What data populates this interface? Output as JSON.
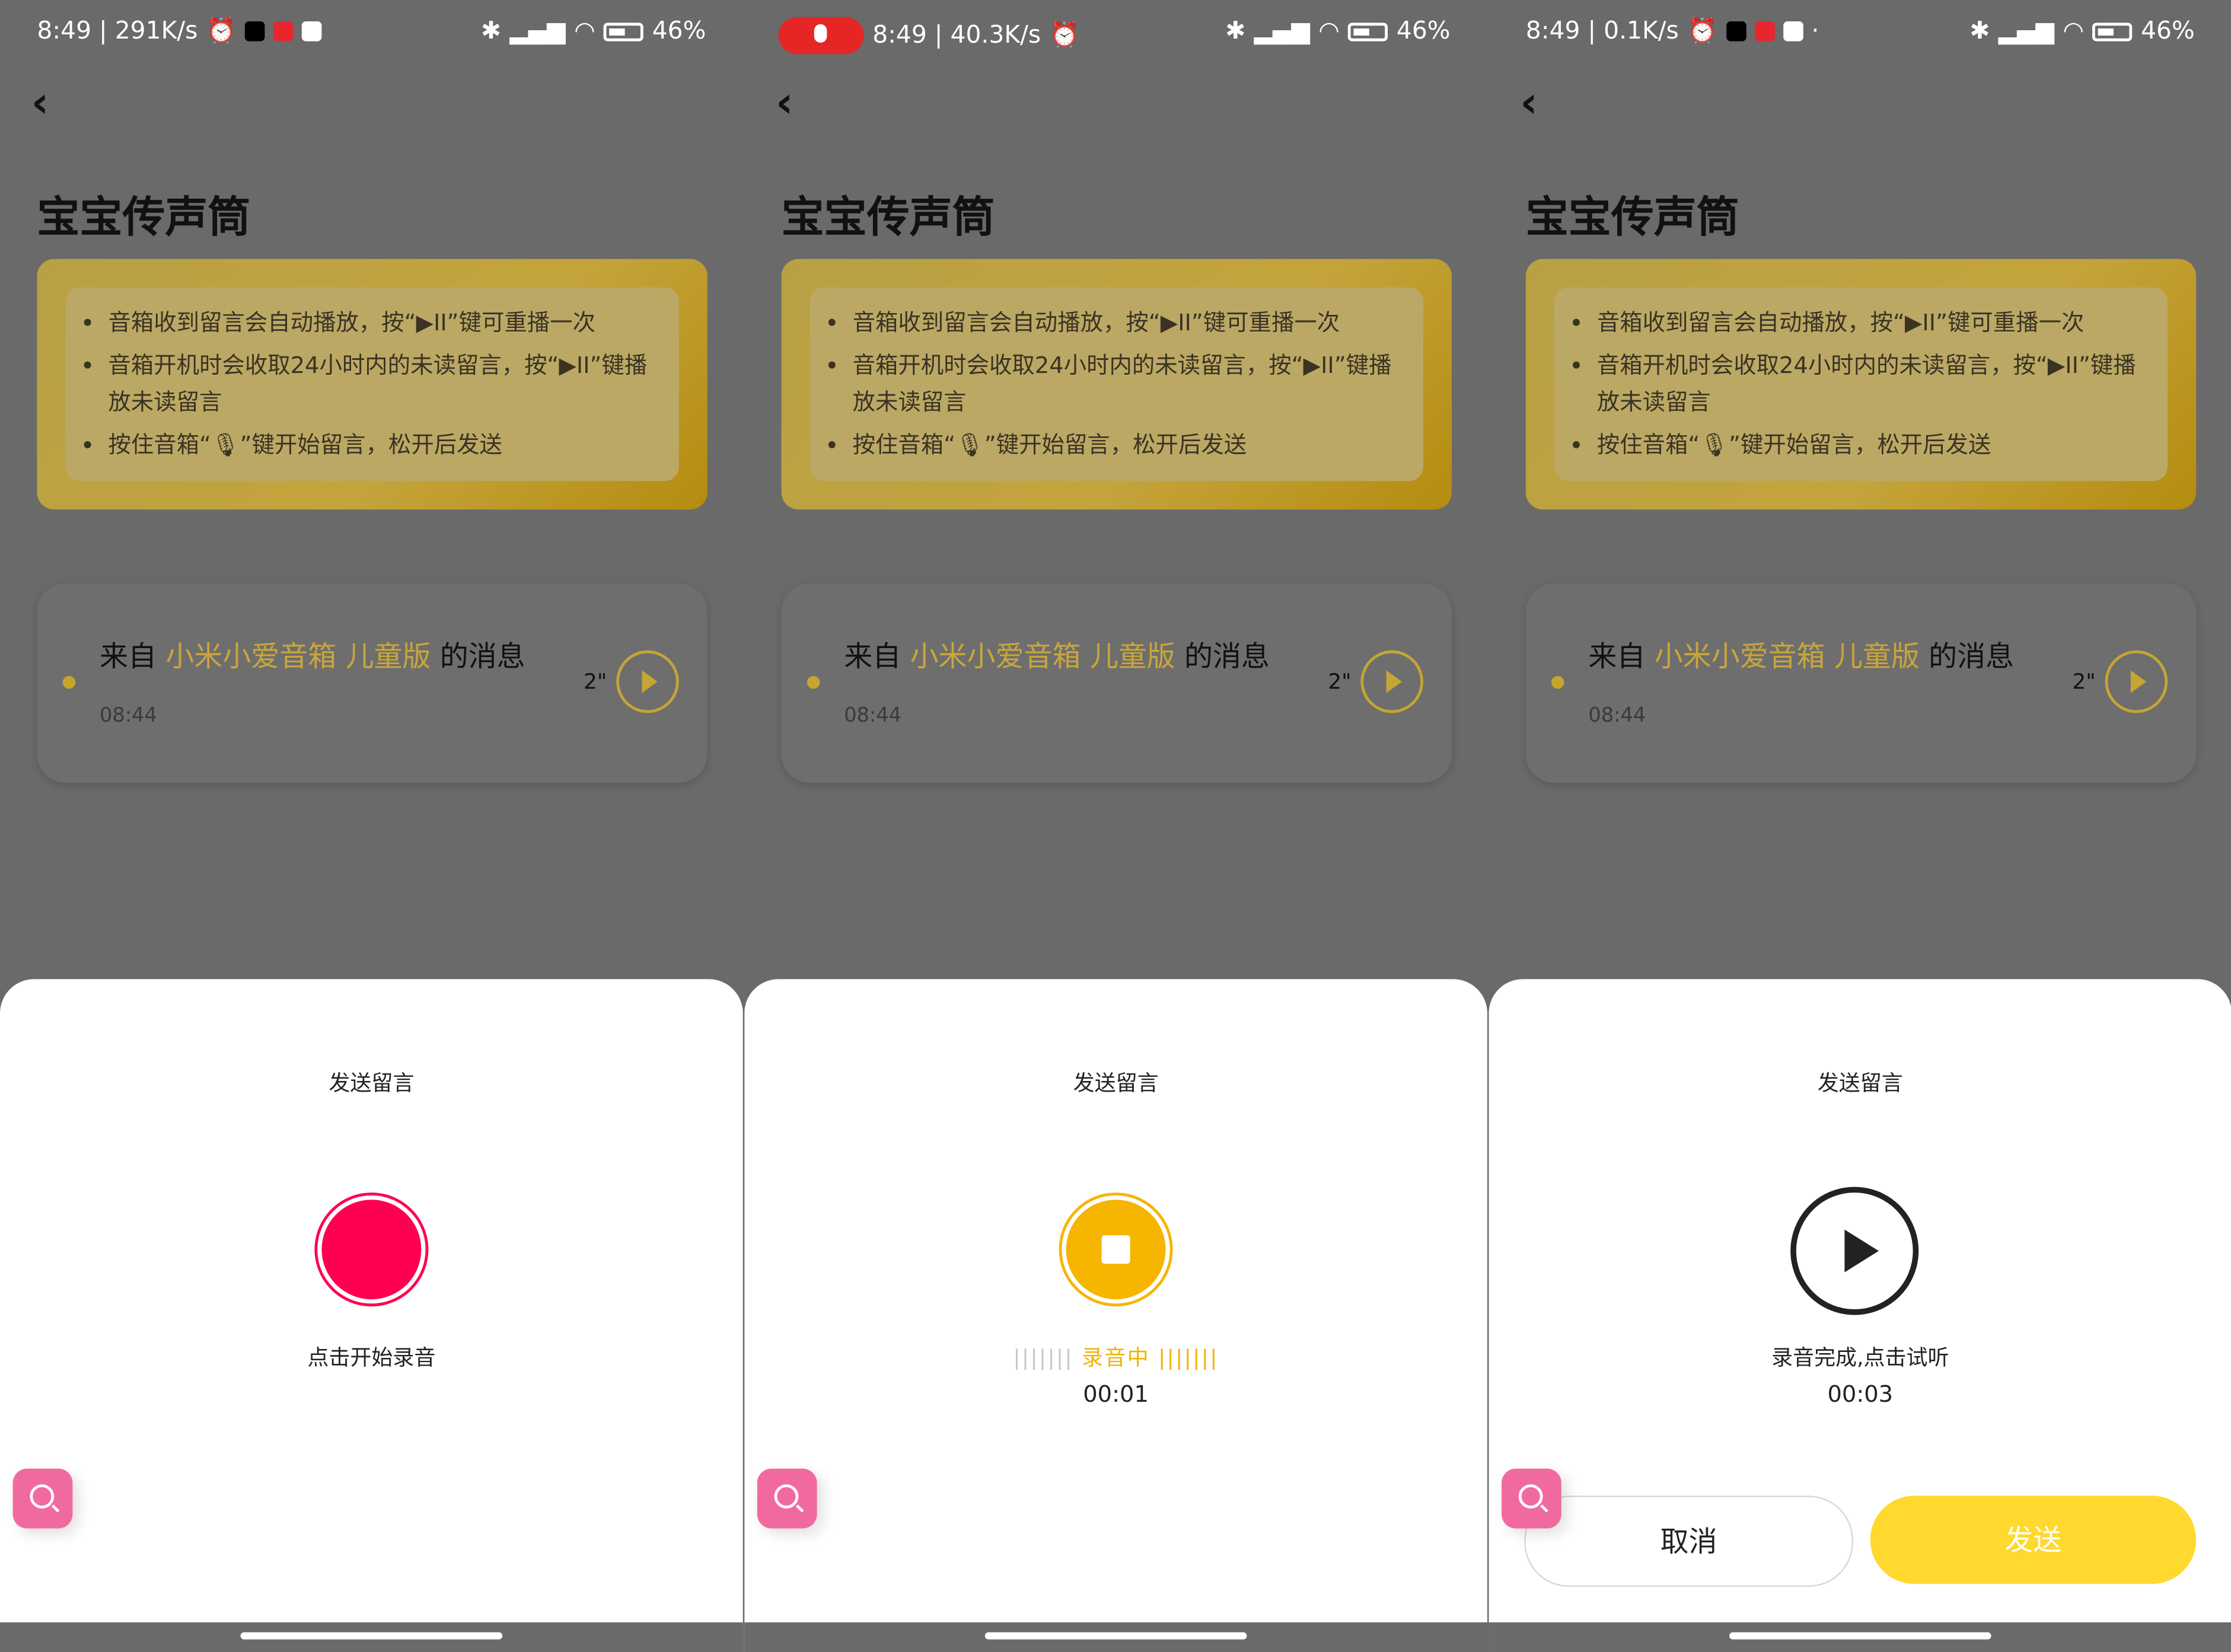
{
  "panels": [
    {
      "status_left": "8:49 | 291K/s",
      "status_right": "46%",
      "page_title": "宝宝传声筒",
      "tips": [
        "音箱收到留言会自动播放，按“▶II”键可重播一次",
        "音箱开机时会收取24小时内的未读留言，按“▶II”键播放未读留言",
        "按住音箱“🎙”键开始留言，松开后发送"
      ],
      "message": {
        "prefix": "来自 ",
        "device": "小米小爱音箱 儿童版",
        "suffix": " 的消息",
        "time": "08:44",
        "duration": "2\""
      },
      "sheet_title": "发送留言",
      "hint": "点击开始录音"
    },
    {
      "status_left": "8:49 | 40.3K/s",
      "status_right": "46%",
      "page_title": "宝宝传声筒",
      "tips": [
        "音箱收到留言会自动播放，按“▶II”键可重播一次",
        "音箱开机时会收取24小时内的未读留言，按“▶II”键播放未读留言",
        "按住音箱“🎙”键开始留言，松开后发送"
      ],
      "message": {
        "prefix": "来自 ",
        "device": "小米小爱音箱 儿童版",
        "suffix": " 的消息",
        "time": "08:44",
        "duration": "2\""
      },
      "sheet_title": "发送留言",
      "recording_label": "录音中",
      "bars_left": "|||||||",
      "bars_right": "|||||||",
      "timer": "00:01"
    },
    {
      "status_left": "8:49 | 0.1K/s",
      "status_right": "46%",
      "page_title": "宝宝传声筒",
      "tips": [
        "音箱收到留言会自动播放，按“▶II”键可重播一次",
        "音箱开机时会收取24小时内的未读留言，按“▶II”键播放未读留言",
        "按住音箱“🎙”键开始留言，松开后发送"
      ],
      "message": {
        "prefix": "来自 ",
        "device": "小米小爱音箱 儿童版",
        "suffix": " 的消息",
        "time": "08:44",
        "duration": "2\""
      },
      "sheet_title": "发送留言",
      "hint": "录音完成,点击试听",
      "timer": "00:03",
      "cancel_label": "取消",
      "send_label": "发送"
    }
  ],
  "icons": {
    "back": "chevron-left-icon",
    "alarm": "alarm-icon",
    "bluetooth": "bluetooth-icon",
    "signal": "signal-icon",
    "wifi": "wifi-icon",
    "battery": "battery-icon",
    "mic": "microphone-icon",
    "zoom": "zoom-in-icon",
    "play": "play-icon",
    "stop": "stop-icon",
    "record": "record-icon"
  },
  "colors": {
    "record": "#ff0050",
    "recording": "#f5b500",
    "send": "#ffd92e",
    "highlight": "#c9a63a"
  }
}
